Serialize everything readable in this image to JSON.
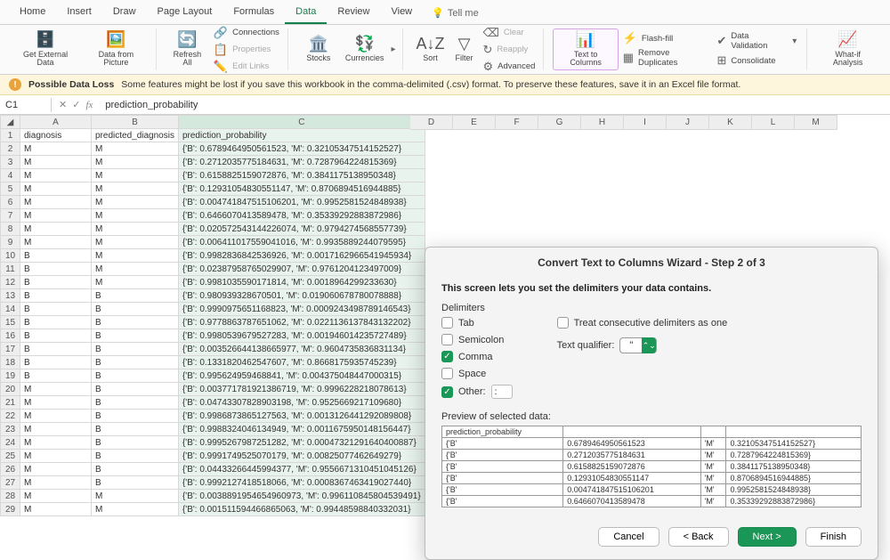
{
  "tabs": [
    "Home",
    "Insert",
    "Draw",
    "Page Layout",
    "Formulas",
    "Data",
    "Review",
    "View"
  ],
  "active_tab_index": 5,
  "tell_me": "Tell me",
  "ribbon": {
    "get_data": "Get External\nData",
    "from_pic": "Data from\nPicture",
    "refresh": "Refresh\nAll",
    "conns": "Connections",
    "props": "Properties",
    "edit_links": "Edit Links",
    "stocks": "Stocks",
    "currencies": "Currencies",
    "sort": "Sort",
    "filter": "Filter",
    "clear": "Clear",
    "reapply": "Reapply",
    "advanced": "Advanced",
    "t2c": "Text to\nColumns",
    "flash": "Flash-fill",
    "dedup": "Remove Duplicates",
    "validate": "Data Validation",
    "consolidate": "Consolidate",
    "whatif": "What-if\nAnalysis"
  },
  "warn": {
    "title": "Possible Data Loss",
    "msg": "Some features might be lost if you save this workbook in the comma-delimited (.csv) format. To preserve these features, save it in an Excel file format."
  },
  "namebox": "C1",
  "formula": "prediction_probability",
  "cols": [
    "A",
    "B",
    "C"
  ],
  "extra_cols": [
    "D",
    "E",
    "F",
    "G",
    "H",
    "I",
    "J",
    "K",
    "L",
    "M"
  ],
  "headers": {
    "A": "diagnosis",
    "B": "predicted_diagnosis",
    "C": "prediction_probability"
  },
  "rows": [
    [
      "M",
      "M",
      "{'B': 0.6789464950561523, 'M': 0.32105347514152527}"
    ],
    [
      "M",
      "M",
      "{'B': 0.2712035775184631, 'M': 0.7287964224815369}"
    ],
    [
      "M",
      "M",
      "{'B': 0.6158825159072876, 'M': 0.3841175138950348}"
    ],
    [
      "M",
      "M",
      "{'B': 0.12931054830551147, 'M': 0.8706894516944885}"
    ],
    [
      "M",
      "M",
      "{'B': 0.004741847515106201, 'M': 0.9952581524848938}"
    ],
    [
      "M",
      "M",
      "{'B': 0.6466070413589478, 'M': 0.35339292883872986}"
    ],
    [
      "M",
      "M",
      "{'B': 0.020572543144226074, 'M': 0.9794274568557739}"
    ],
    [
      "M",
      "M",
      "{'B': 0.006411017559041016, 'M': 0.9935889244079595}"
    ],
    [
      "B",
      "M",
      "{'B': 0.9982836842536926, 'M': 0.0017162966541945934}"
    ],
    [
      "B",
      "M",
      "{'B': 0.02387958765029907, 'M': 0.9761204123497009}"
    ],
    [
      "B",
      "M",
      "{'B': 0.9981035590171814, 'M': 0.0018964299233630}"
    ],
    [
      "B",
      "B",
      "{'B': 0.980939328670501, 'M': 0.019060678780078888}"
    ],
    [
      "B",
      "B",
      "{'B': 0.9990975651168823, 'M': 0.0009243498789146543}"
    ],
    [
      "B",
      "B",
      "{'B': 0.9778863787651062, 'M': 0.0221136137843132202}"
    ],
    [
      "B",
      "B",
      "{'B': 0.9980539679527283, 'M': 0.001946014235727489}"
    ],
    [
      "B",
      "B",
      "{'B': 0.003526644138665977, 'M': 0.9604735836831134}"
    ],
    [
      "B",
      "B",
      "{'B': 0.1331820462547607, 'M': 0.8668175935745239}"
    ],
    [
      "B",
      "B",
      "{'B': 0.995624959468841, 'M': 0.004375048447000315}"
    ],
    [
      "M",
      "B",
      "{'B': 0.003771781921386719, 'M': 0.9996228218078613}"
    ],
    [
      "M",
      "B",
      "{'B': 0.04743307828903198, 'M': 0.9525669217109680}"
    ],
    [
      "M",
      "B",
      "{'B': 0.9986873865127563, 'M': 0.0013126441292089808}"
    ],
    [
      "M",
      "B",
      "{'B': 0.9988324046134949, 'M': 0.0011675950148156447}"
    ],
    [
      "M",
      "B",
      "{'B': 0.9995267987251282, 'M': 0.00047321291640400887}"
    ],
    [
      "M",
      "B",
      "{'B': 0.9991749525070179, 'M': 0.00825077462649279}"
    ],
    [
      "M",
      "B",
      "{'B': 0.04433266445994377, 'M': 0.9556671310451045126}"
    ],
    [
      "M",
      "B",
      "{'B': 0.9992127418518066, 'M': 0.0008367463419027440}"
    ],
    [
      "M",
      "M",
      "{'B': 0.0038891954654960973, 'M': 0.996110845804539491}"
    ],
    [
      "M",
      "M",
      "{'B': 0.001511594466865063, 'M': 0.99448598840332031}"
    ]
  ],
  "wizard": {
    "title": "Convert Text to Columns Wizard - Step 2 of 3",
    "instr": "This screen lets you set the delimiters your data contains.",
    "delim_label": "Delimiters",
    "delims": {
      "tab": "Tab",
      "semicolon": "Semicolon",
      "comma": "Comma",
      "space": "Space",
      "other": "Other:"
    },
    "other_val": ":",
    "consec": "Treat consecutive delimiters as one",
    "qual_label": "Text qualifier:",
    "qual_val": "\"",
    "preview_label": "Preview of selected data:",
    "preview_header": [
      "prediction_probability",
      "",
      ""
    ],
    "preview_rows": [
      [
        "{'B'",
        "0.6789464950561523",
        "'M'",
        "0.32105347514152527}"
      ],
      [
        "{'B'",
        "0.2712035775184631",
        "'M'",
        "0.7287964224815369}"
      ],
      [
        "{'B'",
        "0.6158825159072876",
        "'M'",
        "0.3841175138950348}"
      ],
      [
        "{'B'",
        "0.12931054830551147",
        "'M'",
        "0.8706894516944885}"
      ],
      [
        "{'B'",
        "0.004741847515106201",
        "'M'",
        "0.9952581524848938}"
      ],
      [
        "{'B'",
        "0.6466070413589478",
        "'M'",
        "0.35339292883872986}"
      ]
    ],
    "btns": {
      "cancel": "Cancel",
      "back": "< Back",
      "next": "Next >",
      "finish": "Finish"
    }
  }
}
